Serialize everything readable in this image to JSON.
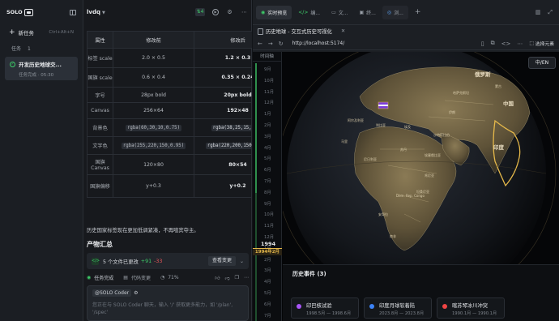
{
  "sidebar": {
    "logo": "SOLO",
    "new_task": "新任务",
    "shortcut": "Ctrl+Alt+N",
    "section": "任务",
    "section_count": "1",
    "task": {
      "title": "开发历史地球交...",
      "status": "任务完成 · 05:30"
    }
  },
  "chat": {
    "title": "lvdq",
    "badge": "4",
    "table": {
      "headers": [
        "属性",
        "修改前",
        "修改后"
      ],
      "rows": [
        {
          "k": "标签 scale",
          "before": "2.0 × 0.5",
          "after": "1.2 × 0.3",
          "code": false
        },
        {
          "k": "国旗 scale",
          "before": "0.6 × 0.4",
          "after": "0.35 × 0.24",
          "code": false
        },
        {
          "k": "字号",
          "before": "28px bold",
          "after": "20px bold",
          "code": false
        },
        {
          "k": "Canvas",
          "before": "256×64",
          "after": "192×48",
          "code": false
        },
        {
          "k": "背景色",
          "before": "rgba(60,30,10,0.75)",
          "after": "rgba(38,25,15,0.8)",
          "code": true
        },
        {
          "k": "文字色",
          "before": "rgba(255,220,150,0.95)",
          "after": "rgba(220,200,150,0.85)",
          "code": true
        },
        {
          "k": "国旗 Canvas",
          "before": "120×80",
          "after": "80×54",
          "code": false
        },
        {
          "k": "国旗偏移",
          "before": "y+0.3",
          "after": "y+0.2",
          "code": false
        }
      ]
    },
    "note": "历史国家标签现在更加低调紧凑，不再喧宾夺主。",
    "products_heading": "产物汇总",
    "files_changed": "5 个文件已更改",
    "additions": "+91",
    "deletions": "-33",
    "view_changes": "查看变更",
    "task_done": "任务完成",
    "code_review": "代码变更",
    "percent": "71%",
    "composer_agent": "@SOLO Coder",
    "composer_placeholder": "您正在与 SOLO Coder 聊天，输入 '/' 获取更多能力，如 '/plan', '/spec'"
  },
  "browser": {
    "tabs": [
      {
        "label": "实时预览",
        "icon": "globe",
        "active": true
      },
      {
        "label": "编...",
        "icon": "code",
        "active": false
      },
      {
        "label": "文...",
        "icon": "doc",
        "active": false
      },
      {
        "label": "终...",
        "icon": "terminal",
        "active": false
      },
      {
        "label": "浏...",
        "icon": "browser",
        "active": false
      }
    ],
    "page_tab": "历史地球 - 交互式历史可视化",
    "url": "http://localhost:5174/",
    "pick_element": "选择元素"
  },
  "app": {
    "timeline_header": "时间轴",
    "months": [
      "9月",
      "10月",
      "11月",
      "12月",
      "1月",
      "2月",
      "3月",
      "4月",
      "5月",
      "6月",
      "7月",
      "8月",
      "9月",
      "10月",
      "11月",
      "12月",
      "1月",
      "2月",
      "3月",
      "4月",
      "5月",
      "6月",
      "7月"
    ],
    "year": "1994",
    "current": "1994年2月",
    "lang_toggle": "中/EN",
    "map_labels": {
      "russia": "俄罗斯",
      "china": "中国",
      "india": "印度",
      "kazakh": "哈萨克斯坦",
      "mongol": "蒙古",
      "iran": "伊朗",
      "saudi": "沙特阿拉伯",
      "egypt": "埃及",
      "libya": "利比亚",
      "algeria": "阿尔及利亚",
      "sudan": "苏丹",
      "ethiopia": "埃塞俄比亚",
      "drc": "Dem. Rep. Congo",
      "angola": "安哥拉",
      "southafrica": "南非",
      "nigeria": "尼日利亚",
      "mali": "马里",
      "tanzania": "坦桑尼亚",
      "kenya": "肯尼亚"
    },
    "events_title": "历史事件",
    "events_count": "(3)",
    "events": [
      {
        "name": "印巴核试验",
        "date": "1998.5月 — 1998.6月",
        "color": "#a855f7"
      },
      {
        "name": "印度月球软着陆",
        "date": "2023.8月 — 2023.8月",
        "color": "#3b82f6"
      },
      {
        "name": "喀苏琴冰川冲突",
        "date": "1990.1月 — 1990.1月",
        "color": "#ef4444"
      }
    ]
  }
}
